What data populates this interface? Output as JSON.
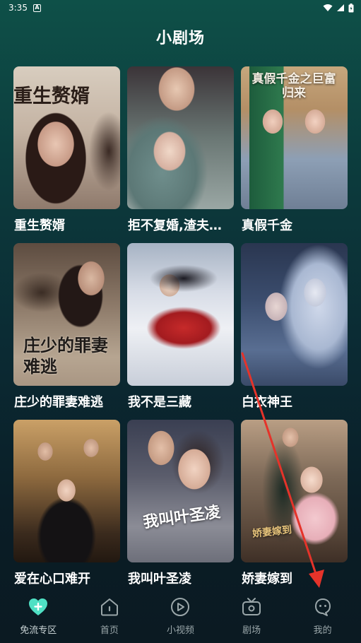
{
  "status_bar": {
    "time": "3:35",
    "notification_icon": "A"
  },
  "header": {
    "title": "小剧场"
  },
  "dramas": [
    {
      "title": "重生赘婿",
      "poster_text": "重生赘婿"
    },
    {
      "title": "拒不复婚,渣夫…",
      "poster_text": ""
    },
    {
      "title": "真假千金",
      "poster_text": "真假千金之巨富归来"
    },
    {
      "title": "庄少的罪妻难逃",
      "poster_text": "庄少的罪妻难逃"
    },
    {
      "title": "我不是三藏",
      "poster_text": ""
    },
    {
      "title": "白衣神王",
      "poster_text": ""
    },
    {
      "title": "爱在心口难开",
      "poster_text": ""
    },
    {
      "title": "我叫叶圣凌",
      "poster_text": "我叫叶圣凌"
    },
    {
      "title": "娇妻嫁到",
      "poster_text": "娇妻嫁到"
    }
  ],
  "tabs": [
    {
      "label": "免流专区",
      "icon": "heart-plus-icon"
    },
    {
      "label": "首页",
      "icon": "home-icon"
    },
    {
      "label": "小视频",
      "icon": "play-icon"
    },
    {
      "label": "剧场",
      "icon": "tv-icon"
    },
    {
      "label": "我的",
      "icon": "profile-icon"
    }
  ],
  "colors": {
    "accent": "#4fe0c4",
    "annotation_arrow": "#e5332a",
    "tab_inactive": "#9aa6a9"
  }
}
